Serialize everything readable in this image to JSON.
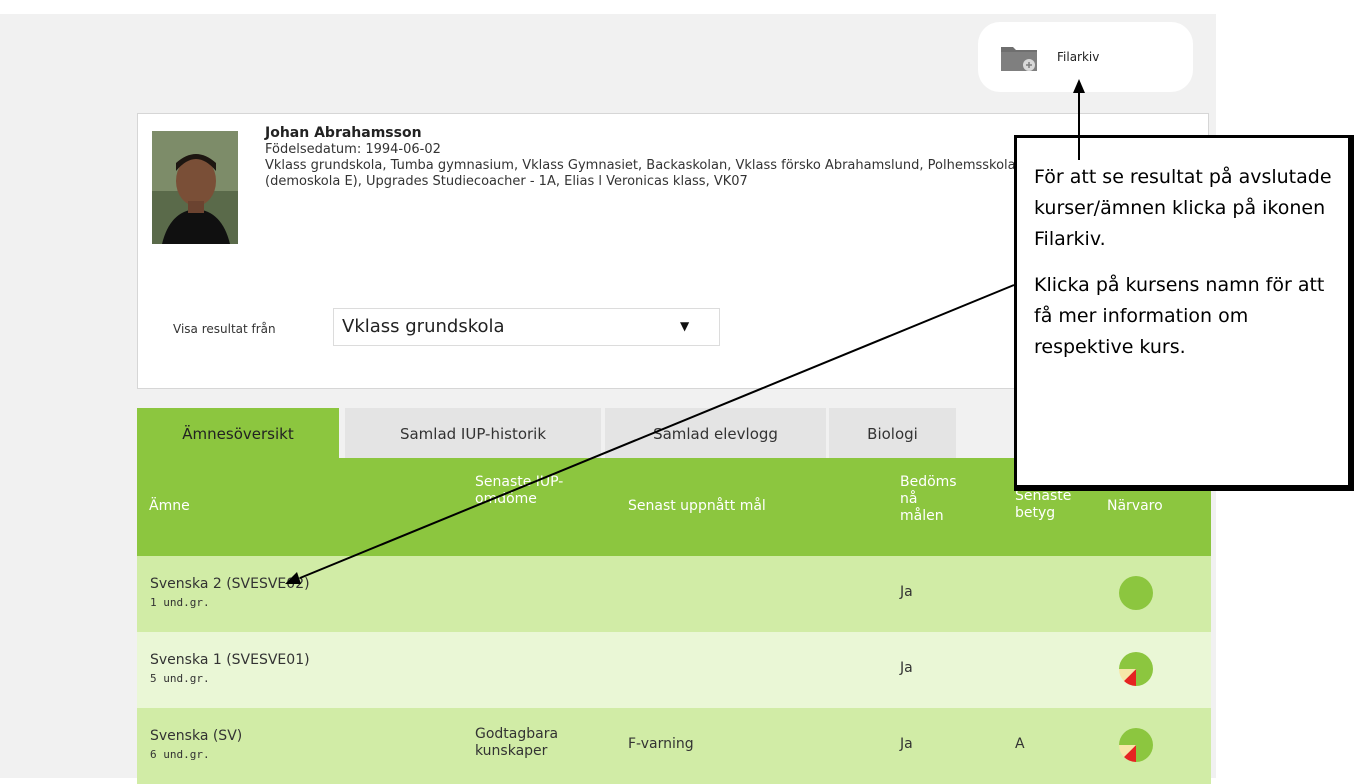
{
  "filarkiv": {
    "label": "Filarkiv",
    "icon": "folder-icon"
  },
  "student": {
    "name": "Johan Abrahamsson",
    "birthdate": "Födelsedatum: 1994-06-02",
    "classes": "Vklass grundskola, Tumba gymnasium, Vklass Gymnasiet, Backaskolan, Vklass försko Abrahamslund, Polhemsskolan (demoskola E), Upgrades Studiecoacher - 1A, Elias l Veronicas klass, VK07"
  },
  "results_filter": {
    "label": "Visa resultat från",
    "selected": "Vklass grundskola",
    "arrow": "▼"
  },
  "tabs": [
    {
      "label": "Ämnesöversikt",
      "active": true
    },
    {
      "label": "Samlad IUP-historik",
      "active": false
    },
    {
      "label": "Samlad elevlogg",
      "active": false
    },
    {
      "label": "Biologi",
      "active": false
    }
  ],
  "table": {
    "headers": {
      "subject": "Ämne",
      "latest_iup": "Senaste IUP-omdöme",
      "latest_goal": "Senast uppnått mål",
      "assessed": "Bedöms nå målen",
      "latest_grade": "Senaste betyg",
      "attendance": "Närvaro"
    },
    "rows": [
      {
        "subject": "Svenska 2 (SVESVE02)",
        "groups": "1 und.gr.",
        "iup": "",
        "goal": "",
        "assessed": "Ja",
        "grade": "",
        "attendance": {
          "present": 1.0,
          "absent": 0.0,
          "other": 0.0
        }
      },
      {
        "subject": "Svenska 1 (SVESVE01)",
        "groups": "5 und.gr.",
        "iup": "",
        "goal": "",
        "assessed": "Ja",
        "grade": "",
        "attendance": {
          "present": 0.75,
          "absent": 0.125,
          "other": 0.125
        }
      },
      {
        "subject": "Svenska (SV)",
        "groups": "6 und.gr.",
        "iup": "Godtagbara kunskaper",
        "goal": "F-varning",
        "assessed": "Ja",
        "grade": "A",
        "attendance": {
          "present": 0.75,
          "absent": 0.125,
          "other": 0.125
        }
      }
    ]
  },
  "callout": {
    "paragraph1": "För att se resultat på avslutade kurser/ämnen klicka på ikonen Filarkiv.",
    "paragraph2": "Klicka på kursens namn för att få mer information om respektive kurs."
  },
  "colors": {
    "accent": "#8cc63f",
    "row_dark": "#d1eca6",
    "row_light": "#eaf7d6",
    "absent": "#e52421",
    "other": "#f6e7a8"
  }
}
